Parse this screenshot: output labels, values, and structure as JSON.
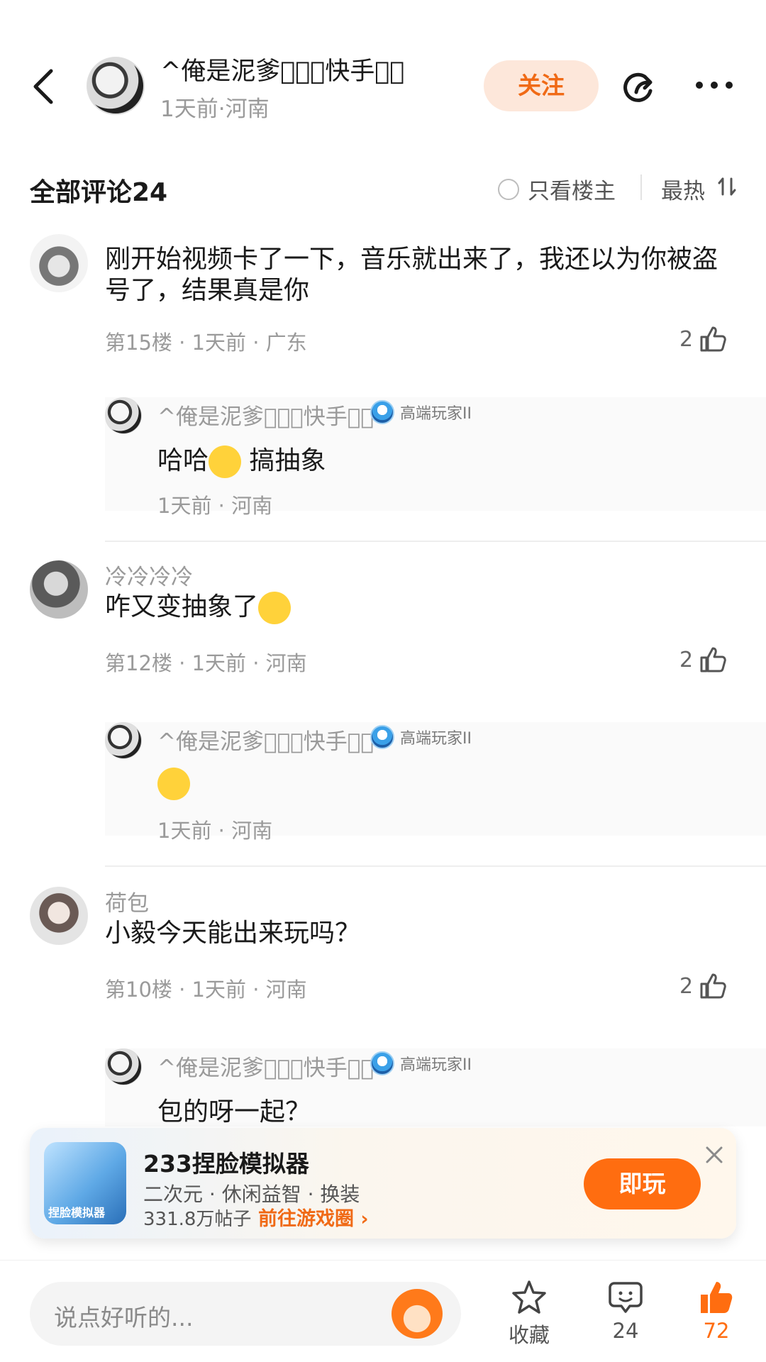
{
  "header": {
    "author_name": "^俺是泥爹\u0000\u0000\u0000快手\u0000\u0000",
    "author_meta": "1天前·河南",
    "follow_label": "关注"
  },
  "comments_header": {
    "title": "全部评论24",
    "only_op_label": "只看楼主",
    "sort_label": "最热"
  },
  "comments": [
    {
      "text": "刚开始视频卡了一下，音乐就出来了，我还以为你被盗号了，结果真是你",
      "meta": "第15楼 · 1天前 · 广东",
      "likes": "2",
      "reply": {
        "name": "^俺是泥爹\u0000\u0000\u0000快手\u0000\u0000",
        "badge": "高端玩家II",
        "text_before": "哈哈",
        "text_after": " 搞抽象",
        "meta": "1天前 · 河南"
      }
    },
    {
      "name": "冷冷冷冷",
      "text": "咋又变抽象了",
      "meta": "第12楼 · 1天前 · 河南",
      "likes": "2",
      "reply": {
        "name": "^俺是泥爹\u0000\u0000\u0000快手\u0000\u0000",
        "badge": "高端玩家II",
        "meta": "1天前 · 河南"
      }
    },
    {
      "name": "荷包",
      "text": "小毅今天能出来玩吗？",
      "meta": "第10楼 · 1天前 · 河南",
      "likes": "2",
      "reply": {
        "name": "^俺是泥爹\u0000\u0000\u0000快手\u0000\u0000",
        "badge": "高端玩家II",
        "text": "包的呀一起？"
      }
    }
  ],
  "ad": {
    "title": "233捏脸模拟器",
    "tags": "二次元 · 休闲益智 · 换装",
    "posts": "331.8万帖子",
    "link_label": "前往游戏圈",
    "play_label": "即玩",
    "icon_text": "捏脸模拟器"
  },
  "bottom_bar": {
    "placeholder": "说点好听的...",
    "favorite_label": "收藏",
    "comment_count": "24",
    "like_count": "72"
  },
  "colors": {
    "accent": "#ff6d10",
    "follow_bg": "#fde7da",
    "muted_text": "#9a9a9a"
  }
}
